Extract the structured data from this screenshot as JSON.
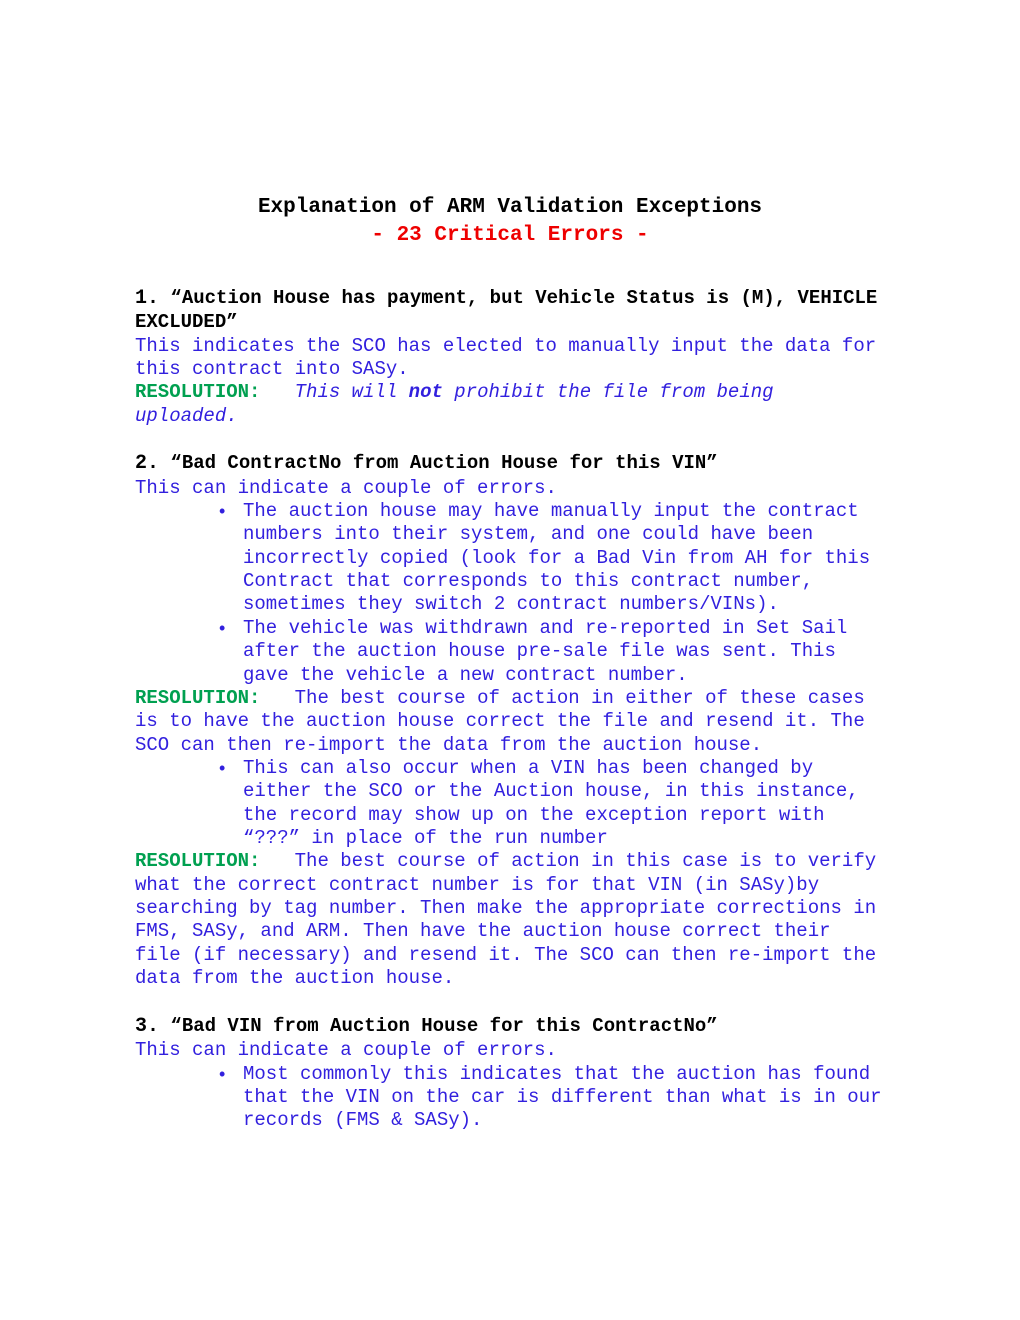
{
  "title": {
    "main": "Explanation of ARM Validation Exceptions",
    "sub": "- 23 Critical Errors -"
  },
  "entries": [
    {
      "num": "1.",
      "heading": "“Auction House has payment, but Vehicle Status is (M), VEHICLE EXCLUDED”",
      "desc1": "This indicates the SCO has elected to manually input the data for this contract into SASy.",
      "resolution_label": "RESOLUTION:",
      "resolution_italic_pre": "This will ",
      "resolution_italic_bold": "not",
      "resolution_italic_post": " prohibit the file from being uploaded."
    },
    {
      "num": "2.",
      "heading": "“Bad ContractNo from Auction House for this VIN”",
      "desc1": "This can indicate a couple of errors.",
      "bullets1": [
        "The auction house may have manually input the contract numbers into their system, and one could have been incorrectly copied (look for a Bad Vin from AH for this Contract that corresponds to this contract number, sometimes they switch 2 contract numbers/VINs).",
        "The vehicle was withdrawn and re-reported in Set Sail after the auction house pre-sale file was sent. This gave the vehicle a new contract number."
      ],
      "resolution1_label": "RESOLUTION:",
      "resolution1_text": "The best course of action in either of these cases is to have the auction house correct the file and resend it. The SCO can then re-import the data from the auction house.",
      "bullets2": [
        "This can also occur when a VIN has been changed by either the SCO or the Auction house, in this instance, the record may show up on the exception report with “???” in place of the run number"
      ],
      "resolution2_label": "RESOLUTION:",
      "resolution2_text": "The best course of action in this case is to verify what the correct contract number is for that VIN (in SASy)by searching by tag number. Then make the appropriate corrections in FMS, SASy, and ARM.  Then have the auction house correct their file (if necessary) and resend it. The SCO can then re-import the data from the auction house."
    },
    {
      "num": "3.",
      "heading": "“Bad VIN from Auction House for this ContractNo”",
      "desc1": "This can indicate a couple of errors.",
      "bullets1": [
        "Most commonly this indicates that the auction has found that the VIN on the car is different than what is in our records (FMS & SASy)."
      ]
    }
  ]
}
